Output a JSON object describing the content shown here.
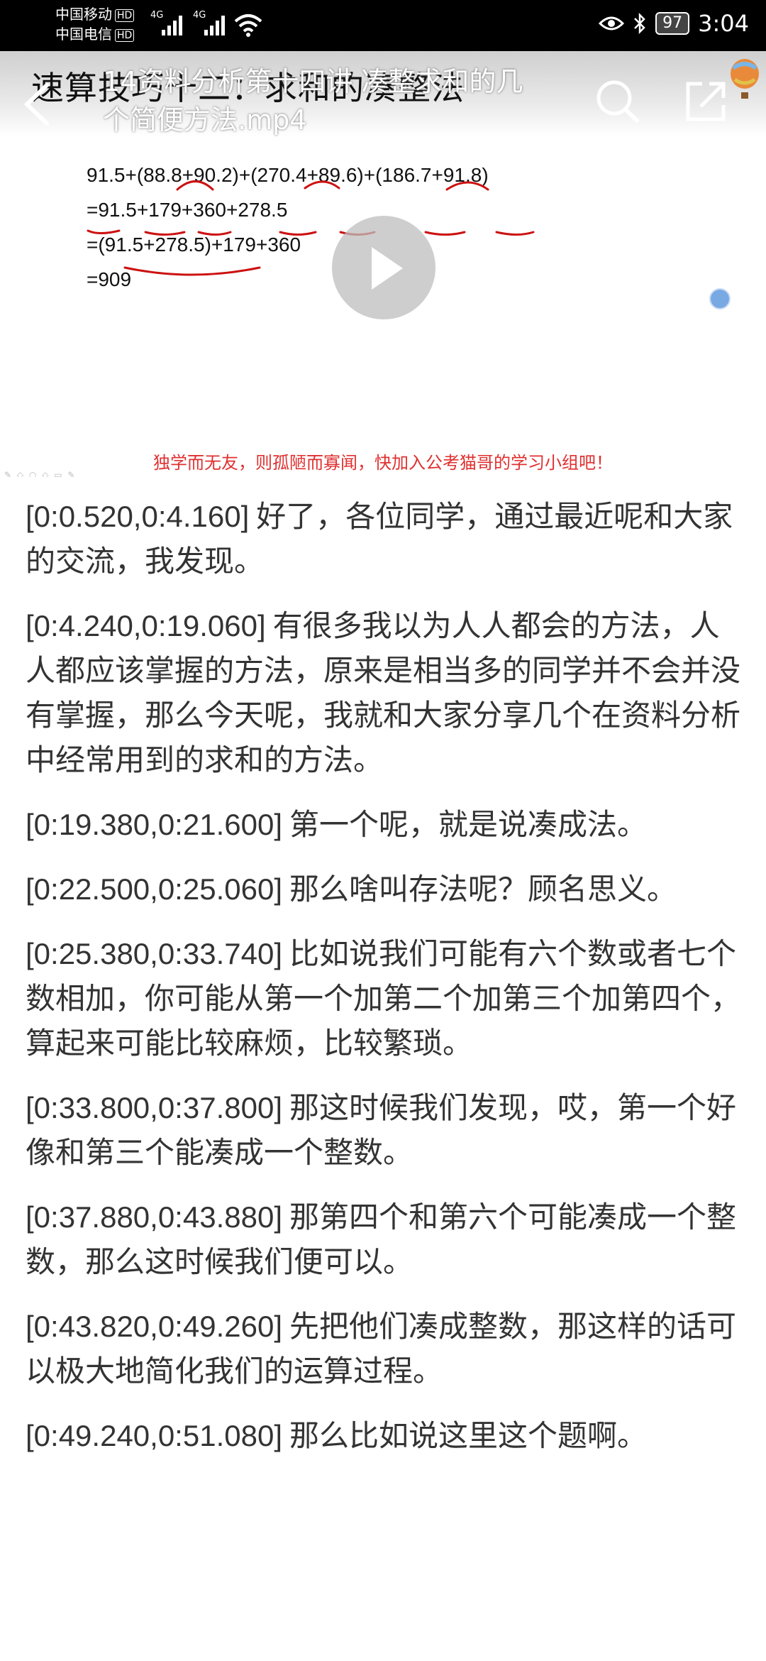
{
  "status_bar": {
    "carrier1": "中国移动",
    "carrier2": "中国电信",
    "hd": "HD",
    "net": "4G",
    "battery": "97",
    "time": "3:04"
  },
  "video": {
    "slide_title": "速算技巧十二：求和的凑整法",
    "title": "14资料分析第十四讲 凑整求和的几个简便方法.mp4",
    "math_lines": [
      "91.5+(88.8+90.2)+(270.4+89.6)+(186.7+91.8)",
      "=91.5+179+360+278.5",
      "=(91.5+278.5)+179+360",
      "=909"
    ],
    "banner": "独学而无友，则孤陋而寡闻，快加入公考猫哥的学习小组吧！"
  },
  "transcript": [
    {
      "ts": "[0:0.520,0:4.160]",
      "text": "好了，各位同学，通过最近呢和大家的交流，我发现。"
    },
    {
      "ts": "[0:4.240,0:19.060]",
      "text": "有很多我以为人人都会的方法，人人都应该掌握的方法，原来是相当多的同学并不会并没有掌握，那么今天呢，我就和大家分享几个在资料分析中经常用到的求和的方法。"
    },
    {
      "ts": "[0:19.380,0:21.600]",
      "text": "第一个呢，就是说凑成法。"
    },
    {
      "ts": "[0:22.500,0:25.060]",
      "text": "那么啥叫存法呢？顾名思义。"
    },
    {
      "ts": "[0:25.380,0:33.740]",
      "text": "比如说我们可能有六个数或者七个数相加，你可能从第一个加第二个加第三个加第四个，算起来可能比较麻烦，比较繁琐。"
    },
    {
      "ts": "[0:33.800,0:37.800]",
      "text": "那这时候我们发现，哎，第一个好像和第三个能凑成一个整数。"
    },
    {
      "ts": "[0:37.880,0:43.880]",
      "text": "那第四个和第六个可能凑成一个整数，那么这时候我们便可以。"
    },
    {
      "ts": "[0:43.820,0:49.260]",
      "text": "先把他们凑成整数，那这样的话可以极大地简化我们的运算过程。"
    },
    {
      "ts": "[0:49.240,0:51.080]",
      "text": "那么比如说这里这个题啊。"
    }
  ]
}
